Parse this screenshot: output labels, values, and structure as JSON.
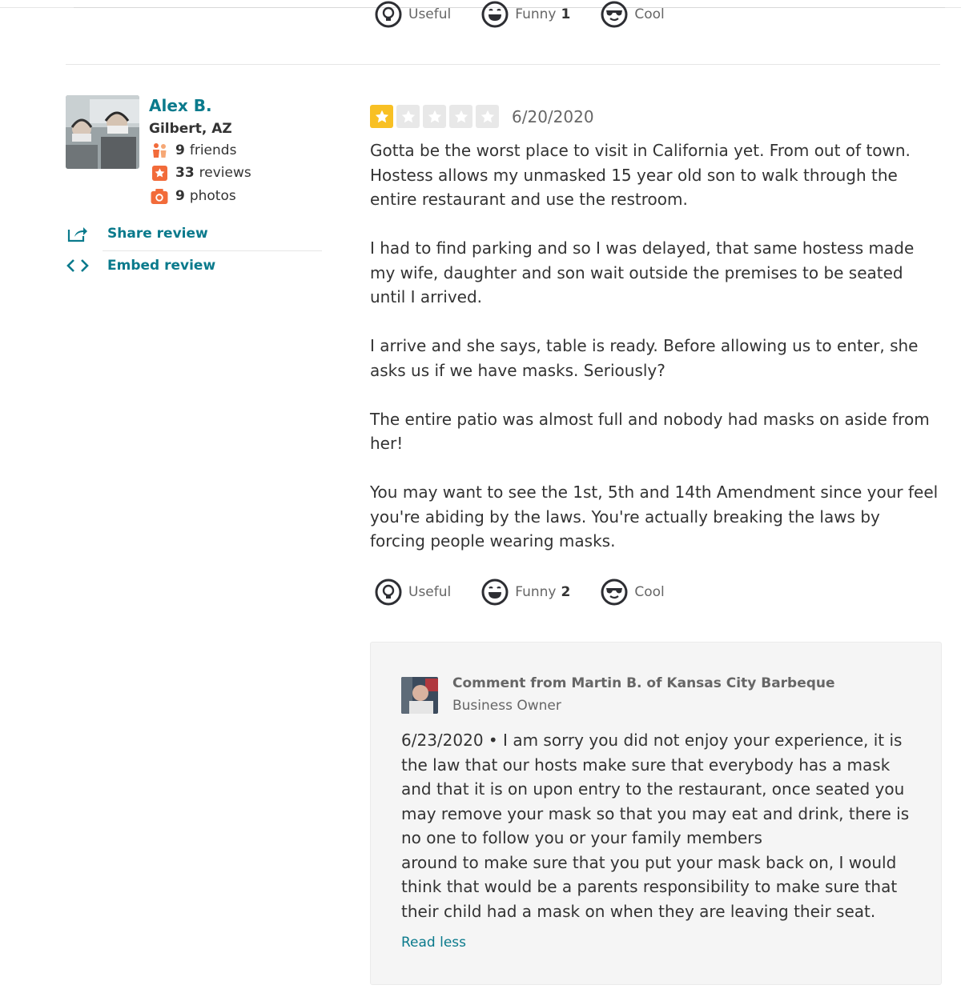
{
  "prev_review": {
    "votes": [
      {
        "label": "Useful",
        "count": "",
        "icon": "useful-icon"
      },
      {
        "label": "Funny",
        "count": "1",
        "icon": "funny-icon"
      },
      {
        "label": "Cool",
        "count": "",
        "icon": "cool-icon"
      }
    ]
  },
  "user": {
    "name": "Alex B.",
    "location": "Gilbert, AZ",
    "friends_count": "9",
    "friends_label": "friends",
    "reviews_count": "33",
    "reviews_label": "reviews",
    "photos_count": "9",
    "photos_label": "photos"
  },
  "actions": {
    "share": "Share review",
    "embed": "Embed review"
  },
  "review": {
    "rating": 1,
    "max_rating": 5,
    "date": "6/20/2020",
    "paragraphs": [
      "Gotta be the worst place to visit in California yet. From out of town. Hostess allows my unmasked 15 year old son to walk through the entire restaurant and use the restroom.",
      "I had to find parking and so I was delayed, that same hostess made my wife, daughter and son wait outside the premises to be seated until I arrived.",
      "I arrive and she says, table is ready. Before allowing us to enter, she asks us if we have masks. Seriously?",
      "The entire patio was almost full and nobody had masks on aside from her!",
      "You may want to see the 1st, 5th and 14th Amendment since your feel you're abiding by the laws. You're actually breaking the laws by forcing people wearing masks."
    ],
    "votes": [
      {
        "label": "Useful",
        "count": "",
        "icon": "useful-icon"
      },
      {
        "label": "Funny",
        "count": "2",
        "icon": "funny-icon"
      },
      {
        "label": "Cool",
        "count": "",
        "icon": "cool-icon"
      }
    ]
  },
  "owner_comment": {
    "header": "Comment from Martin B. of Kansas City Barbeque",
    "role": "Business Owner",
    "text": "6/23/2020 • I am sorry you did not enjoy your experience, it is the law that our hosts make sure that everybody has a mask and that it is on upon entry to the restaurant, once seated you may remove your mask so that you may eat and drink, there is no one to follow you or your family members\naround to make sure that you put your mask back on, I would think that would be a parents responsibility to make sure that their child had a mask on when they are leaving their seat.",
    "read_less": "Read less"
  },
  "colors": {
    "link": "#0a7a8c",
    "star_active": "#f8c024",
    "star_inactive": "#e8e8e8"
  }
}
